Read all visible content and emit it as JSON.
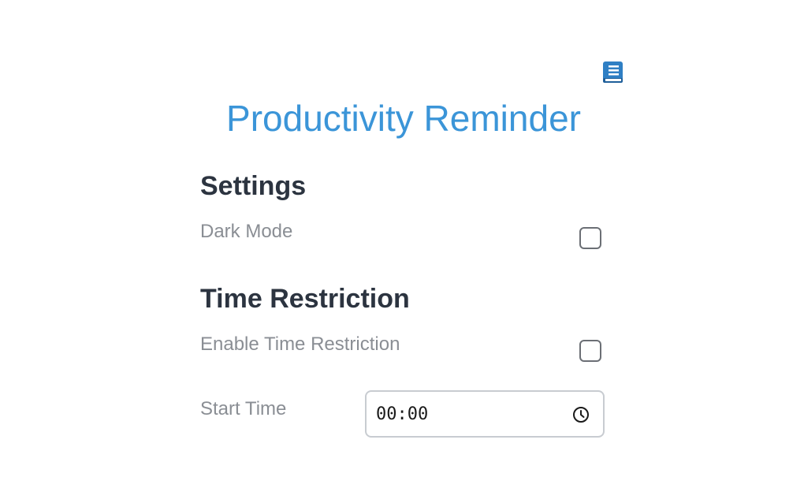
{
  "header": {
    "icon": "book-icon",
    "title": "Productivity Reminder",
    "accent_color": "#3b95d8"
  },
  "settings": {
    "heading": "Settings",
    "dark_mode_label": "Dark Mode",
    "dark_mode_checked": false
  },
  "time_restriction": {
    "heading": "Time Restriction",
    "enable_label": "Enable Time Restriction",
    "enable_checked": false,
    "start_time_label": "Start Time",
    "start_time_value": "00:00",
    "clock_icon": "clock-icon"
  }
}
